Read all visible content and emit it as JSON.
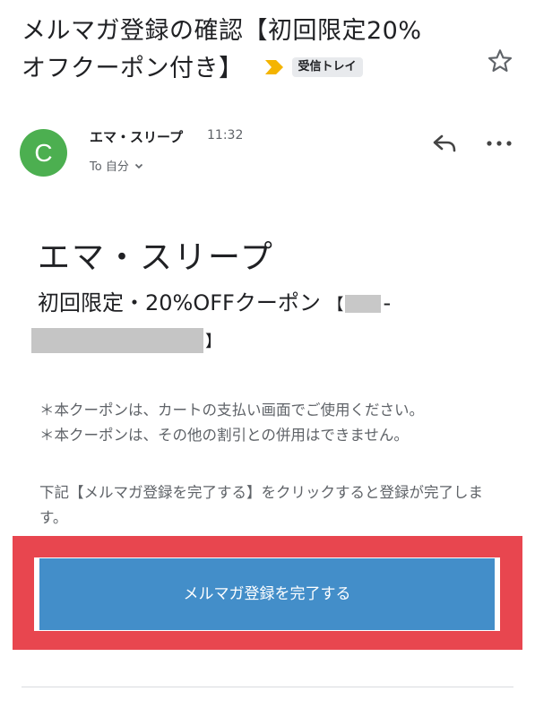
{
  "email": {
    "subject_line1": "メルマガ登録の確認【初回限定20%",
    "subject_line2": "オフクーポン付き】",
    "label": "受信トレイ",
    "sender": {
      "initial": "C",
      "name": "エマ・スリープ",
      "time": "11:32",
      "recipient": "To 自分"
    }
  },
  "body": {
    "brand": "エマ・スリープ",
    "offer": "初回限定・20%OFFクーポン",
    "code_open": "【",
    "code_visible": "-",
    "code_close": "】",
    "note1": "＊本クーポンは、カートの支払い画面でご使用ください。",
    "note2": "＊本クーポンは、その他の割引との併用はできません。",
    "instruction": "下記【メルマガ登録を完了する】をクリックすると登録が完了します。",
    "cta_label": "メルマガ登録を完了する"
  },
  "colors": {
    "avatar": "#4caf50",
    "label_arrow": "#f4b400",
    "cta": "#438ec9",
    "highlight": "#e8464f"
  },
  "icons": [
    "label-arrow-icon",
    "star-icon",
    "chevron-down-icon",
    "reply-icon",
    "more-icon"
  ]
}
